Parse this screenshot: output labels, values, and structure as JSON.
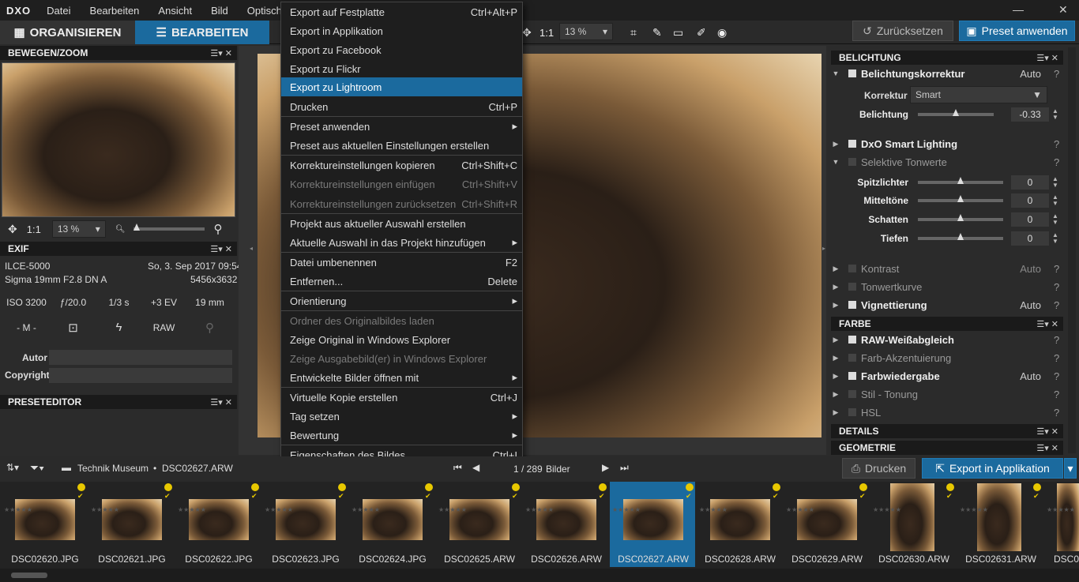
{
  "menubar": {
    "logo": "DXO",
    "items": [
      "Datei",
      "Bearbeiten",
      "Ansicht",
      "Bild",
      "Optische D"
    ],
    "minimize": "—",
    "close": "✕"
  },
  "toolbar": {
    "tab_organize": "ORGANISIEREN",
    "tab_edit": "BEARBEITEN",
    "ratio": "1:1",
    "zoom": "13 %",
    "reset": "Zurücksetzen",
    "apply_preset": "Preset anwenden"
  },
  "left": {
    "move_zoom": {
      "title": "BEWEGEN/ZOOM",
      "ratio": "1:1",
      "zoom": "13 %"
    },
    "exif": {
      "title": "EXIF",
      "camera": "ILCE-5000",
      "date": "So, 3. Sep 2017 09:54",
      "lens": "Sigma 19mm F2.8 DN A",
      "resolution": "5456x3632",
      "iso": "ISO 3200",
      "aperture": "ƒ/20.0",
      "shutter": "1/3 s",
      "ev": "+3 EV",
      "focal": "19 mm",
      "mode": "- M -",
      "format": "RAW",
      "author_label": "Autor",
      "copyright_label": "Copyright"
    },
    "preset_editor": {
      "title": "PRESETEDITOR"
    },
    "panel_controls": "☰▾ ✕"
  },
  "menu": {
    "items": [
      {
        "label": "Export auf Festplatte",
        "shortcut": "Ctrl+Alt+P"
      },
      {
        "label": "Export in Applikation",
        "shortcut": ""
      },
      {
        "label": "Export zu Facebook",
        "shortcut": ""
      },
      {
        "label": "Export zu Flickr",
        "shortcut": ""
      },
      {
        "label": "Export zu Lightroom",
        "shortcut": ""
      },
      {
        "label": "Drucken",
        "shortcut": "Ctrl+P"
      },
      {
        "label": "Preset anwenden",
        "shortcut": "▸"
      },
      {
        "label": "Preset aus aktuellen Einstellungen erstellen",
        "shortcut": ""
      },
      {
        "label": "Korrektureinstellungen kopieren",
        "shortcut": "Ctrl+Shift+C"
      },
      {
        "label": "Korrektureinstellungen einfügen",
        "shortcut": "Ctrl+Shift+V"
      },
      {
        "label": "Korrektureinstellungen zurücksetzen",
        "shortcut": "Ctrl+Shift+R"
      },
      {
        "label": "Projekt aus aktueller Auswahl erstellen",
        "shortcut": ""
      },
      {
        "label": "Aktuelle Auswahl in das Projekt hinzufügen",
        "shortcut": "▸"
      },
      {
        "label": "Datei umbenennen",
        "shortcut": "F2"
      },
      {
        "label": "Entfernen...",
        "shortcut": "Delete"
      },
      {
        "label": "Orientierung",
        "shortcut": "▸"
      },
      {
        "label": "Ordner des Originalbildes laden",
        "shortcut": ""
      },
      {
        "label": "Zeige Original in Windows Explorer",
        "shortcut": ""
      },
      {
        "label": "Zeige Ausgabebild(er) in Windows Explorer",
        "shortcut": ""
      },
      {
        "label": "Entwickelte Bilder öffnen mit",
        "shortcut": "▸"
      },
      {
        "label": "Virtuelle Kopie erstellen",
        "shortcut": "Ctrl+J"
      },
      {
        "label": "Tag setzen",
        "shortcut": "▸"
      },
      {
        "label": "Bewertung",
        "shortcut": "▸"
      },
      {
        "label": "Eigenschaften des Bildes",
        "shortcut": "Ctrl+I"
      }
    ]
  },
  "right": {
    "belichtung": {
      "title": "BELICHTUNG",
      "exposure_correction": "Belichtungskorrektur",
      "auto": "Auto",
      "korrektur_label": "Korrektur",
      "korrektur_value": "Smart",
      "belichtung_label": "Belichtung",
      "belichtung_value": "-0.33"
    },
    "smart_lighting": "DxO Smart Lighting",
    "selective": {
      "title": "Selektive Tonwerte",
      "rows": [
        {
          "label": "Spitzlichter",
          "value": "0"
        },
        {
          "label": "Mitteltöne",
          "value": "0"
        },
        {
          "label": "Schatten",
          "value": "0"
        },
        {
          "label": "Tiefen",
          "value": "0"
        }
      ]
    },
    "kontrast": "Kontrast",
    "tonwertkurve": "Tonwertkurve",
    "vignettierung": "Vignettierung",
    "farbe": {
      "title": "FARBE",
      "raw_wb": "RAW-Weißabgleich",
      "accent": "Farb-Akzentuierung",
      "rendering": "Farbwiedergabe",
      "style": "Stil - Tonung",
      "hsl": "HSL"
    },
    "details": "DETAILS",
    "geometrie": "GEOMETRIE",
    "q": "?"
  },
  "bottom": {
    "path_folder": "Technik Museum",
    "path_file": "DSC02627.ARW",
    "counter": "1 / 289",
    "counter_label": "Bilder",
    "print": "Drucken",
    "export_app": "Export in Applikation"
  },
  "filmstrip": [
    {
      "name": "DSC02620.JPG"
    },
    {
      "name": "DSC02621.JPG"
    },
    {
      "name": "DSC02622.JPG"
    },
    {
      "name": "DSC02623.JPG"
    },
    {
      "name": "DSC02624.JPG"
    },
    {
      "name": "DSC02625.ARW"
    },
    {
      "name": "DSC02626.ARW"
    },
    {
      "name": "DSC02627.ARW"
    },
    {
      "name": "DSC02628.ARW"
    },
    {
      "name": "DSC02629.ARW"
    },
    {
      "name": "DSC02630.ARW"
    },
    {
      "name": "DSC02631.ARW"
    },
    {
      "name": "DSC0"
    }
  ],
  "colors": {
    "accent": "#1b6a9e",
    "badge": "#e8c800"
  }
}
